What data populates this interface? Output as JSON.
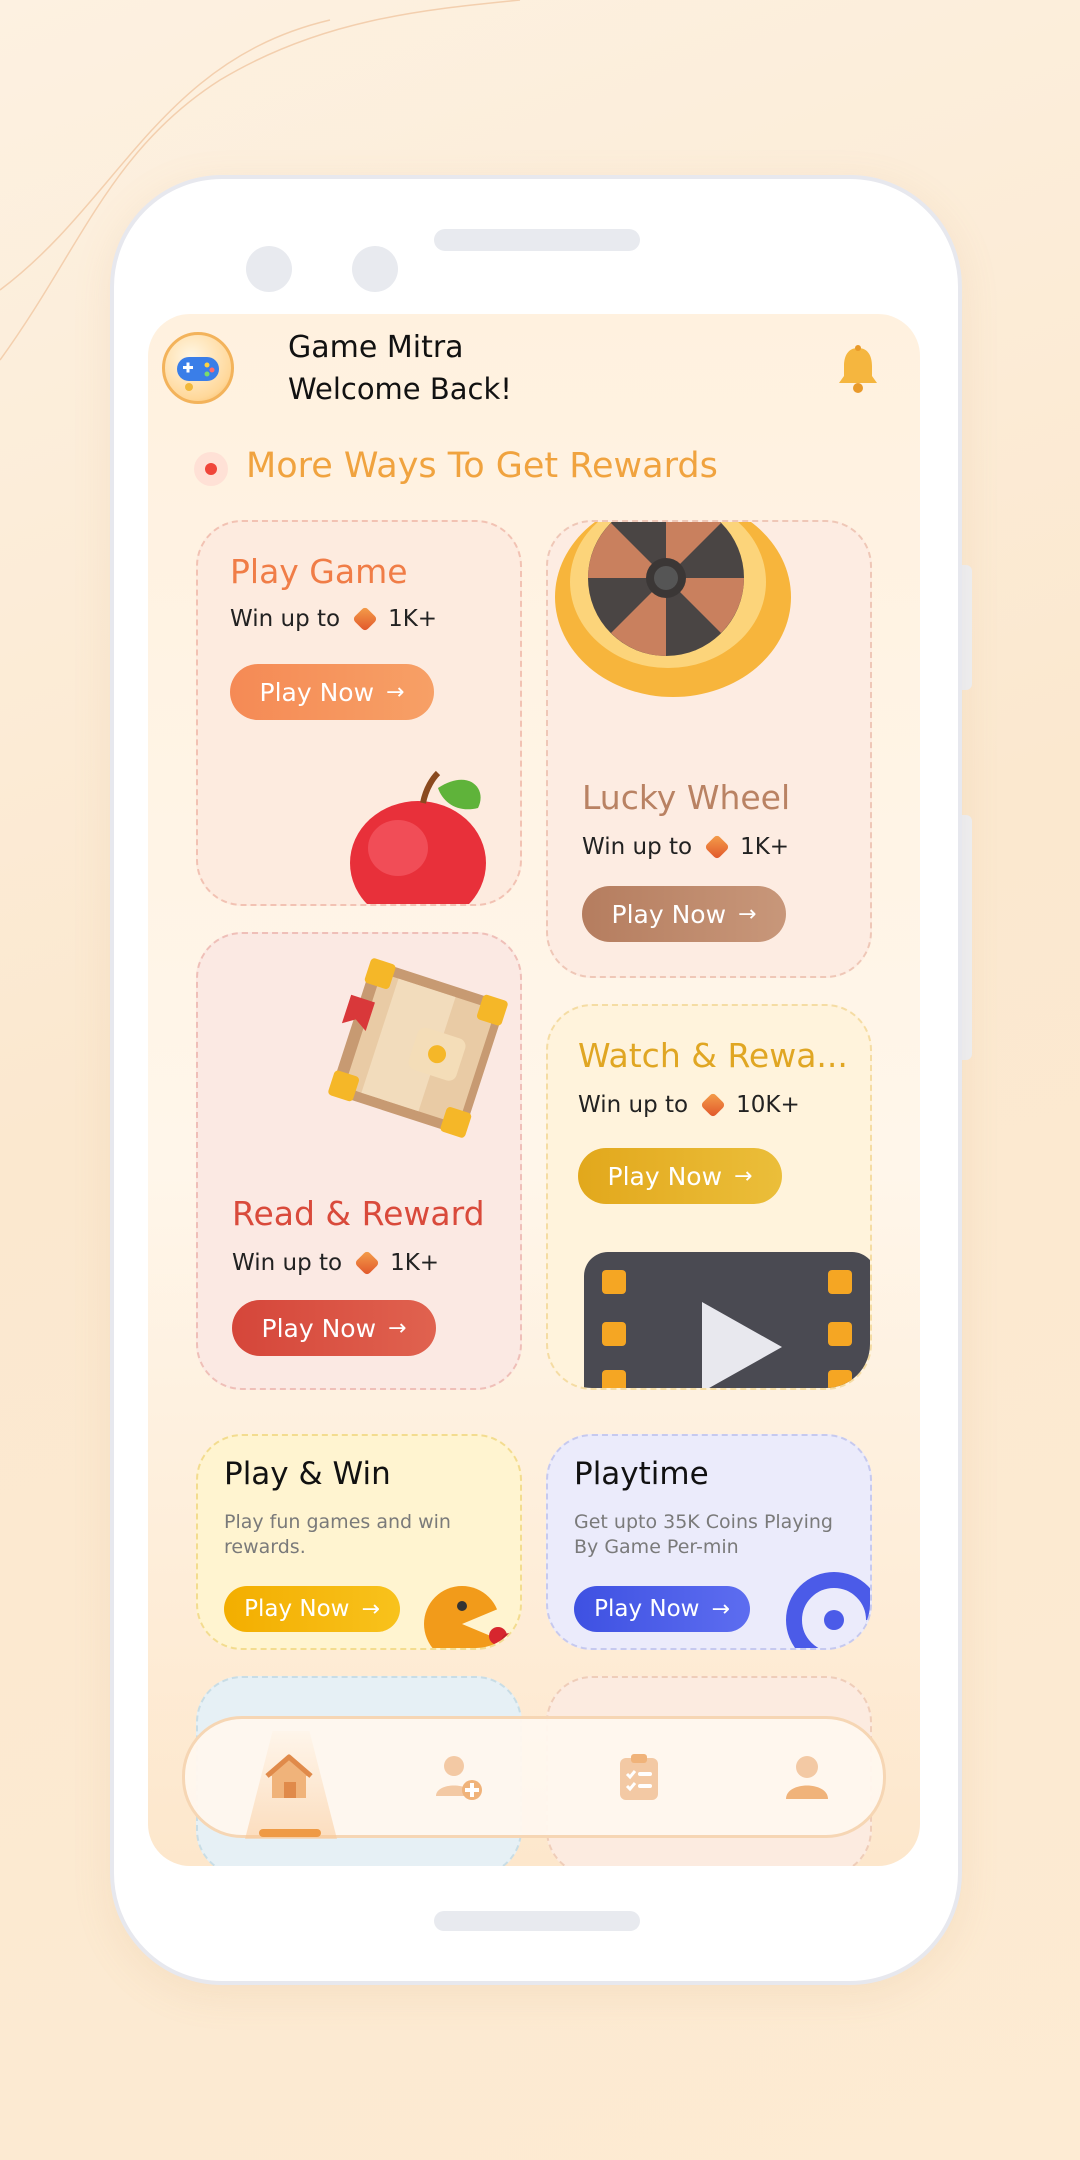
{
  "header": {
    "app_name": "Game Mitra",
    "welcome": "Welcome Back!"
  },
  "section": {
    "title": "More Ways To Get Rewards"
  },
  "cards": {
    "play_game": {
      "title": "Play Game",
      "win_text": "Win up to",
      "amount": "1K+",
      "button": "Play Now"
    },
    "lucky_wheel": {
      "title": "Lucky Wheel",
      "win_text": "Win up to",
      "amount": "1K+",
      "button": "Play Now"
    },
    "read_reward": {
      "title": "Read & Reward",
      "win_text": "Win up to",
      "amount": "1K+",
      "button": "Play Now"
    },
    "watch_reward": {
      "title": "Watch & Rewa...",
      "win_text": "Win up to",
      "amount": "10K+",
      "button": "Play Now"
    },
    "play_win": {
      "title": "Play & Win",
      "desc": "Play fun games and win rewards.",
      "button": "Play Now"
    },
    "playtime": {
      "title": "Playtime",
      "desc": "Get upto 35K Coins Playing By Game Per-min",
      "button": "Play Now"
    }
  },
  "nav": {
    "items": [
      "home-icon",
      "add-user-icon",
      "tasks-icon",
      "profile-icon"
    ],
    "active": 0
  },
  "colors": {
    "accent_orange": "#f0a33f",
    "play_game": "#f77f4a",
    "lucky_wheel": "#b98263",
    "read_reward": "#d94a3b",
    "watch_reward": "#e3a91e",
    "play_win": "#f6b400",
    "playtime": "#4b5be8"
  }
}
